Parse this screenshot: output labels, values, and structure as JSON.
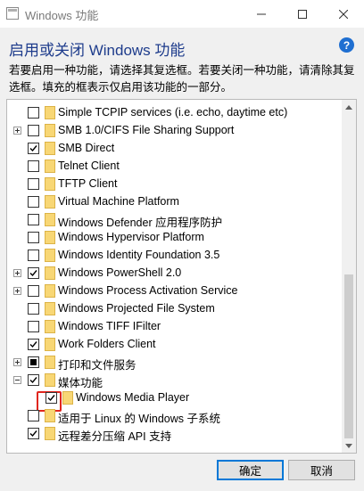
{
  "window": {
    "title": "Windows 功能",
    "controls": [
      "minimize",
      "maximize",
      "close"
    ]
  },
  "header": {
    "title": "启用或关闭 Windows 功能",
    "help_icon": "?",
    "description": "若要启用一种功能，请选择其复选框。若要关闭一种功能，请清除其复选框。填充的框表示仅启用该功能的一部分。"
  },
  "features": [
    {
      "label": "Simple TCPIP services (i.e. echo, daytime etc)",
      "state": "unchecked",
      "expander": "none",
      "level": 0
    },
    {
      "label": "SMB 1.0/CIFS File Sharing Support",
      "state": "unchecked",
      "expander": "plus",
      "level": 0
    },
    {
      "label": "SMB Direct",
      "state": "checked",
      "expander": "none",
      "level": 0
    },
    {
      "label": "Telnet Client",
      "state": "unchecked",
      "expander": "none",
      "level": 0
    },
    {
      "label": "TFTP Client",
      "state": "unchecked",
      "expander": "none",
      "level": 0
    },
    {
      "label": "Virtual Machine Platform",
      "state": "unchecked",
      "expander": "none",
      "level": 0
    },
    {
      "label": "Windows Defender 应用程序防护",
      "state": "unchecked",
      "expander": "none",
      "level": 0
    },
    {
      "label": "Windows Hypervisor Platform",
      "state": "unchecked",
      "expander": "none",
      "level": 0
    },
    {
      "label": "Windows Identity Foundation 3.5",
      "state": "unchecked",
      "expander": "none",
      "level": 0
    },
    {
      "label": "Windows PowerShell 2.0",
      "state": "checked",
      "expander": "plus",
      "level": 0
    },
    {
      "label": "Windows Process Activation Service",
      "state": "unchecked",
      "expander": "plus",
      "level": 0
    },
    {
      "label": "Windows Projected File System",
      "state": "unchecked",
      "expander": "none",
      "level": 0
    },
    {
      "label": "Windows TIFF IFilter",
      "state": "unchecked",
      "expander": "none",
      "level": 0
    },
    {
      "label": "Work Folders Client",
      "state": "checked",
      "expander": "none",
      "level": 0
    },
    {
      "label": "打印和文件服务",
      "state": "partial",
      "expander": "plus",
      "level": 0
    },
    {
      "label": "媒体功能",
      "state": "checked",
      "expander": "minus",
      "level": 0
    },
    {
      "label": "Windows Media Player",
      "state": "checked",
      "expander": "none",
      "level": 1
    },
    {
      "label": "适用于 Linux 的 Windows 子系统",
      "state": "unchecked",
      "expander": "none",
      "level": 0
    },
    {
      "label": "远程差分压缩 API 支持",
      "state": "checked",
      "expander": "none",
      "level": 0
    }
  ],
  "buttons": {
    "ok": "确定",
    "cancel": "取消"
  },
  "colors": {
    "header_text": "#1e3c8c",
    "folder": "#f8d775",
    "highlight": "#e0261e",
    "default_button_border": "#0078d7"
  }
}
